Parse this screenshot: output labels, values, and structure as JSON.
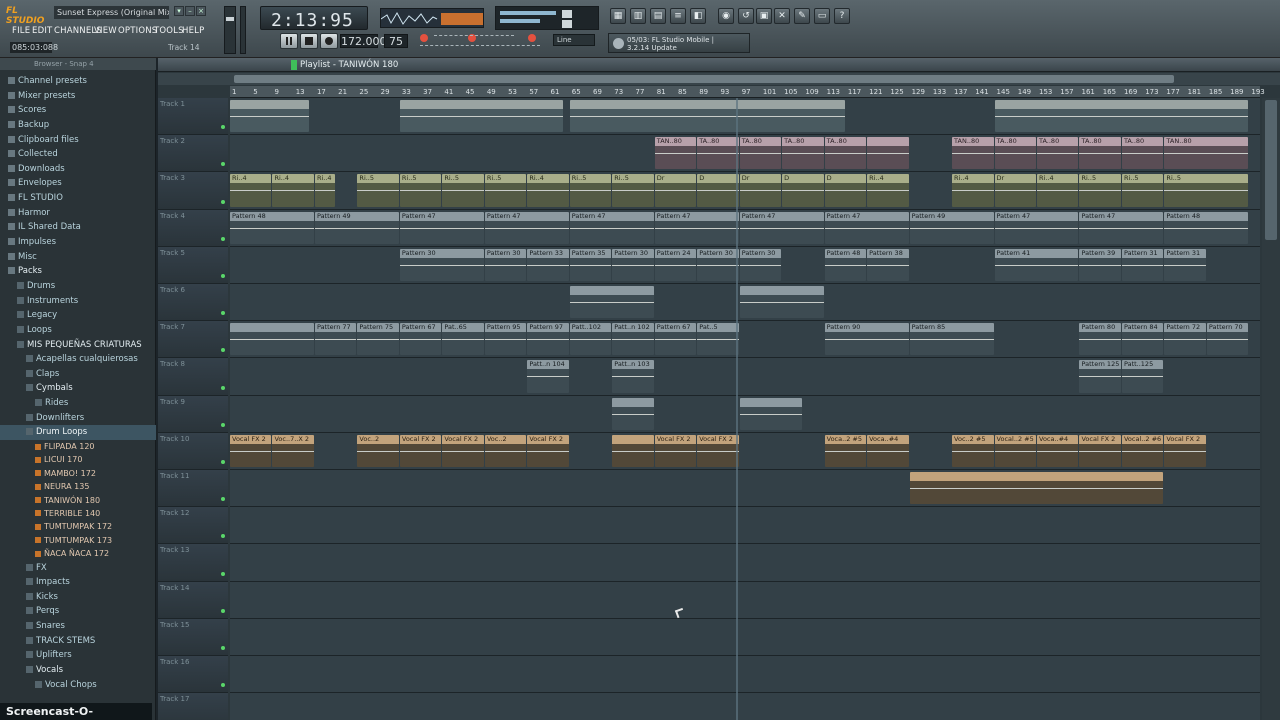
{
  "app": {
    "logo": "FL STUDIO",
    "song_title": "Sunset Express (Original Mix)"
  },
  "menu": [
    "FILE",
    "EDIT",
    "CHANNELS",
    "VIEW",
    "OPTIONS",
    "TOOLS",
    "HELP"
  ],
  "status": {
    "time_readout": "085:03:088",
    "track_label": "Track 14"
  },
  "lcd_time": "2:13:95",
  "tempo": "172.000",
  "pattern_num": "75",
  "snap": "Line",
  "news": {
    "line1": "05/03: FL Studio Mobile |",
    "line2": "3.2.14 Update"
  },
  "browser": {
    "title": "Browser - Snap 4",
    "items": [
      {
        "label": "Channel presets",
        "level": 1,
        "kind": "folder"
      },
      {
        "label": "Mixer presets",
        "level": 1,
        "kind": "folder"
      },
      {
        "label": "Scores",
        "level": 1,
        "kind": "folder"
      },
      {
        "label": "Backup",
        "level": 1,
        "kind": "folder"
      },
      {
        "label": "Clipboard files",
        "level": 1,
        "kind": "folder"
      },
      {
        "label": "Collected",
        "level": 1,
        "kind": "folder"
      },
      {
        "label": "Downloads",
        "level": 1,
        "kind": "folder"
      },
      {
        "label": "Envelopes",
        "level": 1,
        "kind": "folder"
      },
      {
        "label": "FL STUDIO",
        "level": 1,
        "kind": "folder"
      },
      {
        "label": "Harmor",
        "level": 1,
        "kind": "folder"
      },
      {
        "label": "IL Shared Data",
        "level": 1,
        "kind": "folder"
      },
      {
        "label": "Impulses",
        "level": 1,
        "kind": "folder"
      },
      {
        "label": "Misc",
        "level": 1,
        "kind": "folder"
      },
      {
        "label": "Packs",
        "level": 1,
        "kind": "folder",
        "bold": true
      },
      {
        "label": "Drums",
        "level": 2,
        "kind": "folder"
      },
      {
        "label": "Instruments",
        "level": 2,
        "kind": "folder"
      },
      {
        "label": "Legacy",
        "level": 2,
        "kind": "folder"
      },
      {
        "label": "Loops",
        "level": 2,
        "kind": "folder"
      },
      {
        "label": "MIS PEQUEÑAS CRIATURAS",
        "level": 2,
        "kind": "folder",
        "bold": true
      },
      {
        "label": "Acapellas cualquierosas",
        "level": 3,
        "kind": "folder"
      },
      {
        "label": "Claps",
        "level": 3,
        "kind": "folder"
      },
      {
        "label": "Cymbals",
        "level": 3,
        "kind": "folder",
        "bold": true
      },
      {
        "label": "Rides",
        "level": 4,
        "kind": "folder"
      },
      {
        "label": "Downlifters",
        "level": 3,
        "kind": "folder"
      },
      {
        "label": "Drum Loops",
        "level": 3,
        "kind": "folder",
        "selected": true
      },
      {
        "label": "FLIPADA 120",
        "level": 4,
        "kind": "file"
      },
      {
        "label": "LICUI 170",
        "level": 4,
        "kind": "file"
      },
      {
        "label": "MAMBO! 172",
        "level": 4,
        "kind": "file"
      },
      {
        "label": "NEURA 135",
        "level": 4,
        "kind": "file"
      },
      {
        "label": "TANIWÓN 180",
        "level": 4,
        "kind": "file"
      },
      {
        "label": "TERRIBLE 140",
        "level": 4,
        "kind": "file"
      },
      {
        "label": "TUMTUMPAK 172",
        "level": 4,
        "kind": "file"
      },
      {
        "label": "TUMTUMPAK 173",
        "level": 4,
        "kind": "file"
      },
      {
        "label": "ÑACA ÑACA 172",
        "level": 4,
        "kind": "file"
      },
      {
        "label": "FX",
        "level": 3,
        "kind": "folder"
      },
      {
        "label": "Impacts",
        "level": 3,
        "kind": "folder"
      },
      {
        "label": "Kicks",
        "level": 3,
        "kind": "folder"
      },
      {
        "label": "Perqs",
        "level": 3,
        "kind": "folder"
      },
      {
        "label": "Snares",
        "level": 3,
        "kind": "folder"
      },
      {
        "label": "TRACK STEMS",
        "level": 3,
        "kind": "folder"
      },
      {
        "label": "Uplifters",
        "level": 3,
        "kind": "folder"
      },
      {
        "label": "Vocals",
        "level": 3,
        "kind": "folder",
        "bold": true
      },
      {
        "label": "Vocal Chops",
        "level": 4,
        "kind": "folder"
      }
    ]
  },
  "playlist": {
    "title": "Playlist - TANIWÓN 180",
    "ruler": [
      "1",
      "5",
      "9",
      "13",
      "17",
      "21",
      "25",
      "29",
      "33",
      "37",
      "41",
      "45",
      "49",
      "53",
      "57",
      "61",
      "65",
      "69",
      "73",
      "77",
      "81",
      "85",
      "89",
      "93",
      "97",
      "101",
      "105",
      "109",
      "113",
      "117",
      "121",
      "125",
      "129",
      "133",
      "137",
      "141",
      "145",
      "149",
      "153",
      "157",
      "161",
      "165",
      "169",
      "173",
      "177",
      "181",
      "185",
      "189",
      "193"
    ],
    "tracks": [
      {
        "name": "Track 1",
        "clips": [
          {
            "s": 1,
            "e": 16,
            "c": "ag",
            "t": ""
          },
          {
            "s": 33,
            "e": 64,
            "c": "ag",
            "t": ""
          },
          {
            "s": 65,
            "e": 117,
            "c": "ag",
            "t": ""
          },
          {
            "s": 145,
            "e": 193,
            "c": "ag",
            "t": ""
          }
        ]
      },
      {
        "name": "Track 2",
        "clips": [
          {
            "s": 81,
            "e": 89,
            "c": "ap",
            "t": "TAN..80"
          },
          {
            "s": 89,
            "e": 97,
            "c": "ap",
            "t": "TA..80"
          },
          {
            "s": 97,
            "e": 105,
            "c": "ap",
            "t": "TA..80"
          },
          {
            "s": 105,
            "e": 113,
            "c": "ap",
            "t": "TA..80"
          },
          {
            "s": 113,
            "e": 121,
            "c": "ap",
            "t": "TA..80"
          },
          {
            "s": 121,
            "e": 129,
            "c": "ap",
            "t": ""
          },
          {
            "s": 137,
            "e": 145,
            "c": "ap",
            "t": "TAN..80"
          },
          {
            "s": 145,
            "e": 153,
            "c": "ap",
            "t": "TA..80"
          },
          {
            "s": 153,
            "e": 161,
            "c": "ap",
            "t": "TA..80"
          },
          {
            "s": 161,
            "e": 169,
            "c": "ap",
            "t": "TA..80"
          },
          {
            "s": 169,
            "e": 177,
            "c": "ap",
            "t": "TA..80"
          },
          {
            "s": 177,
            "e": 193,
            "c": "ap",
            "t": "TAN..80"
          }
        ]
      },
      {
        "name": "Track 3",
        "clips": [
          {
            "s": 1,
            "e": 9,
            "c": "ay",
            "t": "Ri..4"
          },
          {
            "s": 9,
            "e": 17,
            "c": "ay",
            "t": "Ri..4"
          },
          {
            "s": 17,
            "e": 21,
            "c": "ay",
            "t": "Ri..4"
          },
          {
            "s": 25,
            "e": 33,
            "c": "ay",
            "t": "Ri..5"
          },
          {
            "s": 33,
            "e": 41,
            "c": "ay",
            "t": "Ri..5"
          },
          {
            "s": 41,
            "e": 49,
            "c": "ay",
            "t": "Ri..5"
          },
          {
            "s": 49,
            "e": 57,
            "c": "ay",
            "t": "Ri..5"
          },
          {
            "s": 57,
            "e": 65,
            "c": "ay",
            "t": "Ri..4"
          },
          {
            "s": 65,
            "e": 73,
            "c": "ay",
            "t": "Ri..5"
          },
          {
            "s": 73,
            "e": 81,
            "c": "ay",
            "t": "Ri..5"
          },
          {
            "s": 81,
            "e": 89,
            "c": "ay",
            "t": "Dr"
          },
          {
            "s": 89,
            "e": 97,
            "c": "ay",
            "t": "D"
          },
          {
            "s": 97,
            "e": 105,
            "c": "ay",
            "t": "Dr"
          },
          {
            "s": 105,
            "e": 113,
            "c": "ay",
            "t": "D"
          },
          {
            "s": 113,
            "e": 121,
            "c": "ay",
            "t": "D"
          },
          {
            "s": 121,
            "e": 129,
            "c": "ay",
            "t": "Ri..4"
          },
          {
            "s": 137,
            "e": 145,
            "c": "ay",
            "t": "Ri..4"
          },
          {
            "s": 145,
            "e": 153,
            "c": "ay",
            "t": "Dr"
          },
          {
            "s": 153,
            "e": 161,
            "c": "ay",
            "t": "Ri..4"
          },
          {
            "s": 161,
            "e": 169,
            "c": "ay",
            "t": "Ri..5"
          },
          {
            "s": 169,
            "e": 177,
            "c": "ay",
            "t": "Ri..5"
          },
          {
            "s": 177,
            "e": 193,
            "c": "ay",
            "t": "Ri..5"
          }
        ]
      },
      {
        "name": "Track 4",
        "clips": [
          {
            "s": 1,
            "e": 17,
            "c": "pt",
            "t": "Pattern 48"
          },
          {
            "s": 17,
            "e": 33,
            "c": "pt",
            "t": "Pattern 49"
          },
          {
            "s": 33,
            "e": 49,
            "c": "pt",
            "t": "Pattern 47"
          },
          {
            "s": 49,
            "e": 65,
            "c": "pt",
            "t": "Pattern 47"
          },
          {
            "s": 65,
            "e": 81,
            "c": "pt",
            "t": "Pattern 47"
          },
          {
            "s": 81,
            "e": 97,
            "c": "pt",
            "t": "Pattern 47"
          },
          {
            "s": 97,
            "e": 113,
            "c": "pt",
            "t": "Pattern 47"
          },
          {
            "s": 113,
            "e": 129,
            "c": "pt",
            "t": "Pattern 47"
          },
          {
            "s": 129,
            "e": 145,
            "c": "pt",
            "t": "Pattern 49"
          },
          {
            "s": 145,
            "e": 161,
            "c": "pt",
            "t": "Pattern 47"
          },
          {
            "s": 161,
            "e": 177,
            "c": "pt",
            "t": "Pattern 47"
          },
          {
            "s": 177,
            "e": 193,
            "c": "pt",
            "t": "Pattern 48"
          }
        ]
      },
      {
        "name": "Track 5",
        "clips": [
          {
            "s": 33,
            "e": 49,
            "c": "pt",
            "t": "Pattern 30"
          },
          {
            "s": 49,
            "e": 57,
            "c": "pt",
            "t": "Pattern 30"
          },
          {
            "s": 57,
            "e": 65,
            "c": "pt",
            "t": "Pattern 33"
          },
          {
            "s": 65,
            "e": 73,
            "c": "pt",
            "t": "Pattern 35"
          },
          {
            "s": 73,
            "e": 81,
            "c": "pt",
            "t": "Pattern 30"
          },
          {
            "s": 81,
            "e": 89,
            "c": "pt",
            "t": "Pattern 24"
          },
          {
            "s": 89,
            "e": 97,
            "c": "pt",
            "t": "Pattern 30"
          },
          {
            "s": 97,
            "e": 105,
            "c": "pt",
            "t": "Pattern 30"
          },
          {
            "s": 113,
            "e": 121,
            "c": "pt",
            "t": "Pattern 48"
          },
          {
            "s": 121,
            "e": 129,
            "c": "pt",
            "t": "Pattern 38"
          },
          {
            "s": 145,
            "e": 161,
            "c": "pt",
            "t": "Pattern 41"
          },
          {
            "s": 161,
            "e": 169,
            "c": "pt",
            "t": "Pattern 39"
          },
          {
            "s": 169,
            "e": 177,
            "c": "pt",
            "t": "Pattern 31"
          },
          {
            "s": 177,
            "e": 185,
            "c": "pt",
            "t": "Pattern 31"
          }
        ]
      },
      {
        "name": "Track 6",
        "clips": [
          {
            "s": 65,
            "e": 81,
            "c": "pt",
            "t": ""
          },
          {
            "s": 97,
            "e": 113,
            "c": "pt",
            "t": ""
          }
        ]
      },
      {
        "name": "Track 7",
        "clips": [
          {
            "s": 1,
            "e": 17,
            "c": "pt",
            "t": ""
          },
          {
            "s": 17,
            "e": 25,
            "c": "pt",
            "t": "Pattern 77"
          },
          {
            "s": 25,
            "e": 33,
            "c": "pt",
            "t": "Pattern 75"
          },
          {
            "s": 33,
            "e": 41,
            "c": "pt",
            "t": "Pattern 67"
          },
          {
            "s": 41,
            "e": 49,
            "c": "pt",
            "t": "Pat..65"
          },
          {
            "s": 49,
            "e": 57,
            "c": "pt",
            "t": "Pattern 95"
          },
          {
            "s": 57,
            "e": 65,
            "c": "pt",
            "t": "Pattern 97"
          },
          {
            "s": 65,
            "e": 73,
            "c": "pt",
            "t": "Patt..102"
          },
          {
            "s": 73,
            "e": 81,
            "c": "pt",
            "t": "Patt..n 102"
          },
          {
            "s": 81,
            "e": 89,
            "c": "pt",
            "t": "Pattern 67"
          },
          {
            "s": 89,
            "e": 97,
            "c": "pt",
            "t": "Pat..5"
          },
          {
            "s": 113,
            "e": 129,
            "c": "pt",
            "t": "Pattern 90"
          },
          {
            "s": 129,
            "e": 145,
            "c": "pt",
            "t": "Pattern 85"
          },
          {
            "s": 161,
            "e": 169,
            "c": "pt",
            "t": "Pattern 80"
          },
          {
            "s": 169,
            "e": 177,
            "c": "pt",
            "t": "Pattern 84"
          },
          {
            "s": 177,
            "e": 185,
            "c": "pt",
            "t": "Pattern 72"
          },
          {
            "s": 185,
            "e": 193,
            "c": "pt",
            "t": "Pattern 70"
          }
        ]
      },
      {
        "name": "Track 8",
        "clips": [
          {
            "s": 57,
            "e": 65,
            "c": "pt",
            "t": "Patt..n 104"
          },
          {
            "s": 73,
            "e": 81,
            "c": "pt",
            "t": "Patt..n 103"
          },
          {
            "s": 161,
            "e": 169,
            "c": "pt",
            "t": "Pattern 125"
          },
          {
            "s": 169,
            "e": 177,
            "c": "pt",
            "t": "Patt..125"
          }
        ]
      },
      {
        "name": "Track 9",
        "clips": [
          {
            "s": 73,
            "e": 81,
            "c": "pt",
            "t": ""
          },
          {
            "s": 97,
            "e": 109,
            "c": "pt",
            "t": ""
          }
        ]
      },
      {
        "name": "Track 10",
        "clips": [
          {
            "s": 1,
            "e": 9,
            "c": "vc",
            "t": "Vocal FX 2"
          },
          {
            "s": 9,
            "e": 17,
            "c": "vc",
            "t": "Voc..7..X 2"
          },
          {
            "s": 25,
            "e": 33,
            "c": "vc",
            "t": "Voc..2"
          },
          {
            "s": 33,
            "e": 41,
            "c": "vc",
            "t": "Vocal FX 2"
          },
          {
            "s": 41,
            "e": 49,
            "c": "vc",
            "t": "Vocal FX 2"
          },
          {
            "s": 49,
            "e": 57,
            "c": "vc",
            "t": "Voc..2"
          },
          {
            "s": 57,
            "e": 65,
            "c": "vc",
            "t": "Vocal FX 2"
          },
          {
            "s": 73,
            "e": 81,
            "c": "vc",
            "t": ""
          },
          {
            "s": 81,
            "e": 89,
            "c": "vc",
            "t": "Vocal FX 2"
          },
          {
            "s": 89,
            "e": 97,
            "c": "vc",
            "t": "Vocal FX 2"
          },
          {
            "s": 113,
            "e": 121,
            "c": "vc",
            "t": "Voca..2 #5"
          },
          {
            "s": 121,
            "e": 129,
            "c": "vc",
            "t": "Voca..#4"
          },
          {
            "s": 137,
            "e": 145,
            "c": "vc",
            "t": "Voc..2 #5"
          },
          {
            "s": 145,
            "e": 153,
            "c": "vc",
            "t": "Vocal..2 #5"
          },
          {
            "s": 153,
            "e": 161,
            "c": "vc",
            "t": "Voca..#4"
          },
          {
            "s": 161,
            "e": 169,
            "c": "vc",
            "t": "Vocal FX 2"
          },
          {
            "s": 169,
            "e": 177,
            "c": "vc",
            "t": "Vocal..2 #6"
          },
          {
            "s": 177,
            "e": 185,
            "c": "vc",
            "t": "Vocal FX 2"
          }
        ]
      },
      {
        "name": "Track 11",
        "clips": [
          {
            "s": 129,
            "e": 177,
            "c": "vc",
            "t": ""
          }
        ]
      },
      {
        "name": "Track 12",
        "clips": []
      },
      {
        "name": "Track 13",
        "clips": []
      },
      {
        "name": "Track 14",
        "clips": []
      },
      {
        "name": "Track 15",
        "clips": []
      },
      {
        "name": "Track 16",
        "clips": []
      },
      {
        "name": "Track 17",
        "clips": []
      }
    ]
  },
  "watermark": "Screencast-O-Matic.com",
  "colors": {
    "accent": "#f0a020",
    "play_green": "#3fbf5a"
  }
}
